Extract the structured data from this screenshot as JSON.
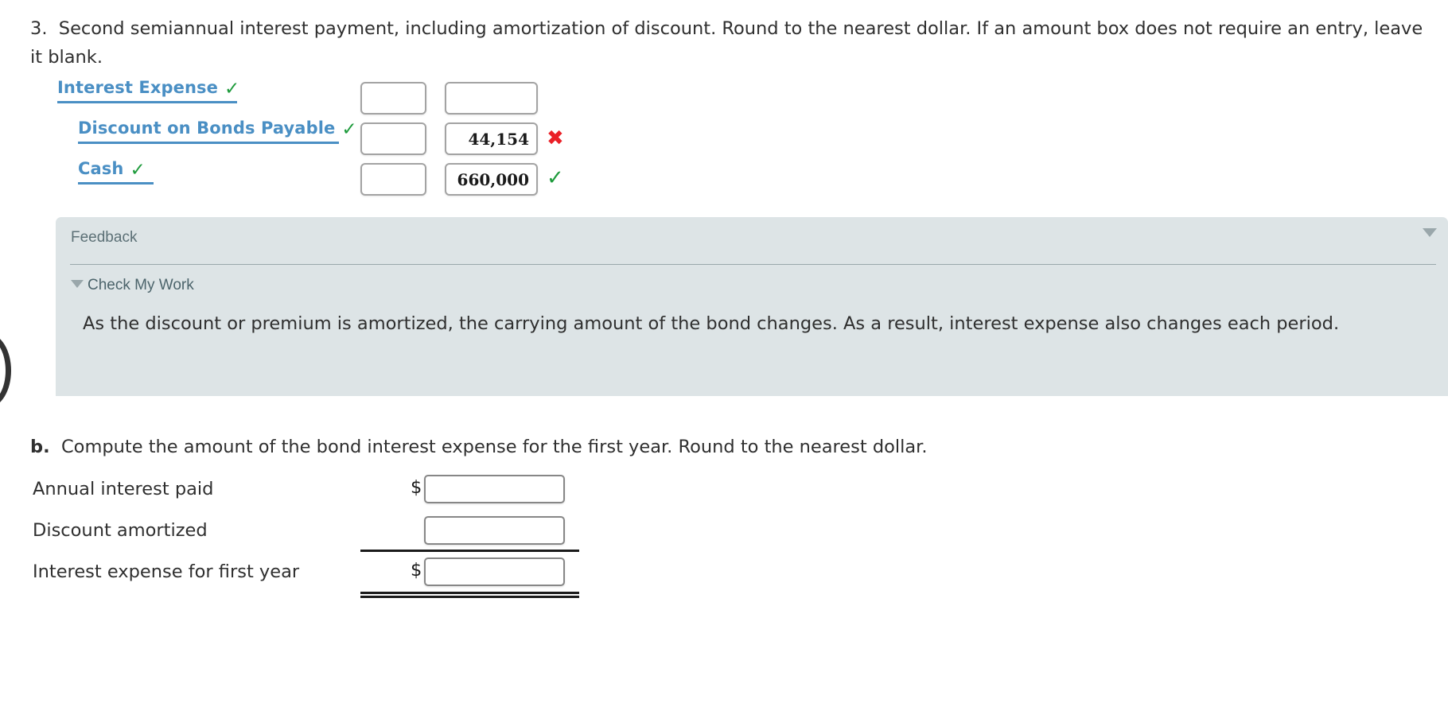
{
  "question": {
    "number": "3.",
    "text": "Second semiannual interest payment, including amortization of discount. Round to the nearest dollar. If an amount box does not require an entry, leave it blank."
  },
  "journal": {
    "rows": [
      {
        "account": "Interest Expense",
        "indent": 72,
        "underline_width": 226,
        "account_status_icon": "green-check-icon",
        "account_status": "✓",
        "debit": "",
        "credit": "",
        "result_icon": "",
        "result": "",
        "result_state": "none"
      },
      {
        "account": "Discount on Bonds Payable",
        "indent": 98,
        "underline_width": 328,
        "account_status_icon": "green-check-icon",
        "account_status": "✓",
        "debit": "",
        "credit": "44,154",
        "result_icon": "red-x-icon",
        "result": "✖",
        "result_state": "bad"
      },
      {
        "account": "Cash",
        "indent": 98,
        "underline_width": 95,
        "account_status_icon": "green-check-icon",
        "account_status": "✓",
        "debit": "",
        "credit": "660,000",
        "result_icon": "green-check-icon",
        "result": "✓",
        "result_state": "ok"
      }
    ],
    "input_placeholder": ""
  },
  "feedback": {
    "title": "Feedback",
    "collapse_icon": "triangle-down-icon",
    "check_my_work_label": "Check My Work",
    "check_my_work_icon": "triangle-down-icon",
    "body": "As the discount or premium is amortized, the carrying amount of the bond changes. As a result, interest expense also changes each period."
  },
  "part_b": {
    "letter": "b.",
    "text": "Compute the amount of the bond interest expense for the first year. Round to the nearest dollar.",
    "rows": [
      {
        "label": "Annual interest paid",
        "currency": "$",
        "value": "",
        "rule": "none"
      },
      {
        "label": "Discount amortized",
        "currency": "",
        "value": "",
        "rule": "single"
      },
      {
        "label": "Interest expense for first year",
        "currency": "$",
        "value": "",
        "rule": "double"
      }
    ],
    "input_placeholder": ""
  },
  "colors": {
    "link_blue": "#4a8fc4",
    "correct_green": "#1e9b3c",
    "incorrect_red": "#ea2027",
    "feedback_bg": "#dde4e6",
    "feedback_text": "#5c7076",
    "body_text": "#2f2f2f"
  }
}
